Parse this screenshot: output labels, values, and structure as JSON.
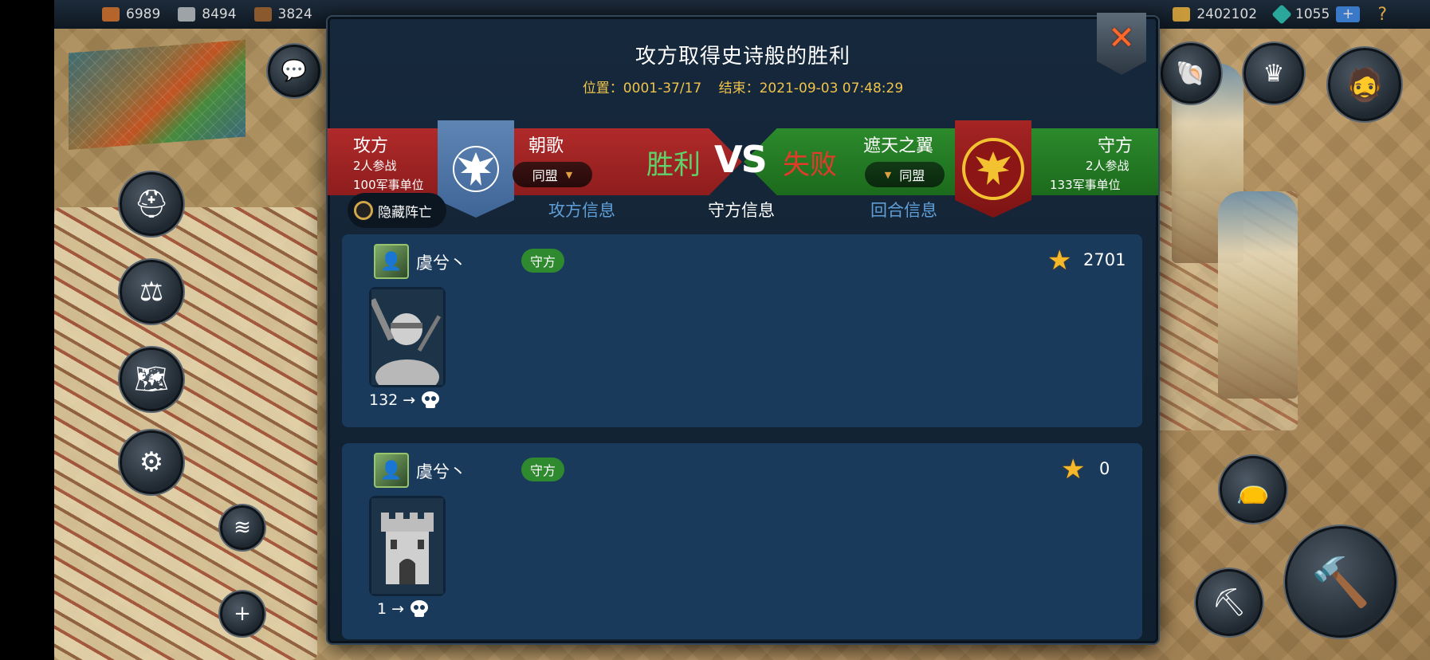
{
  "topbar": {
    "resources": [
      {
        "icon": "wood-icon",
        "value": "6989",
        "color": "#b5652b"
      },
      {
        "icon": "stone-icon",
        "value": "8494",
        "color": "#9ea3a8"
      },
      {
        "icon": "lumber-icon",
        "value": "3824",
        "color": "#8a5a2e"
      }
    ],
    "gold": "2402102",
    "gems": "1055"
  },
  "dialog": {
    "title": "攻方取得史诗般的胜利",
    "location": "位置：0001-37/17",
    "end_time": "结束：2021-09-03 07:48:29"
  },
  "attacker": {
    "side_label": "攻方",
    "participants": "2人参战",
    "units": "100军事单位",
    "name": "朝歌",
    "alliance": "同盟",
    "result": "胜利"
  },
  "vs": "VS",
  "defender": {
    "side_label": "守方",
    "participants": "2人参战",
    "units": "133军事单位",
    "name": "遮天之翼",
    "alliance": "同盟",
    "result": "失败"
  },
  "toggle": {
    "label": "隐藏阵亡"
  },
  "tabs": {
    "attack": "攻方信息",
    "defense": "守方信息",
    "round": "回合信息"
  },
  "entries": [
    {
      "player": "虞兮丶",
      "role": "守方",
      "score": "2701",
      "unit_icon": "soldier-icon",
      "loss": "132 →"
    },
    {
      "player": "虞兮丶",
      "role": "守方",
      "score": "0",
      "unit_icon": "tower-icon",
      "loss": "1 →"
    }
  ]
}
